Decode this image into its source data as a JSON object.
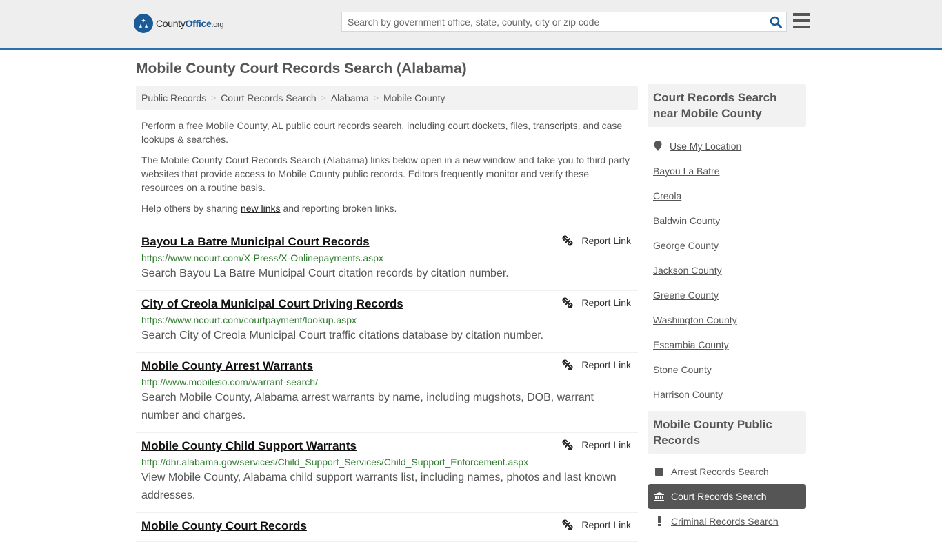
{
  "header": {
    "logo": {
      "county": "County",
      "office": "Office",
      "org": ".org"
    },
    "search_placeholder": "Search by government office, state, county, city or zip code",
    "colors": {
      "brand": "#1b5a98",
      "header_border": "#2d6fa8"
    }
  },
  "page_title": "Mobile County Court Records Search (Alabama)",
  "breadcrumb": [
    "Public Records",
    "Court Records Search",
    "Alabama",
    "Mobile County"
  ],
  "intro": {
    "p1": "Perform a free Mobile County, AL public court records search, including court dockets, files, transcripts, and case lookups & searches.",
    "p2": "The Mobile County Court Records Search (Alabama) links below open in a new window and take you to third party websites that provide access to Mobile County public records. Editors frequently monitor and verify these resources on a routine basis.",
    "p3_before": "Help others by sharing ",
    "p3_link": "new links",
    "p3_after": " and reporting broken links."
  },
  "report_label": "Report Link",
  "results": [
    {
      "title": "Bayou La Batre Municipal Court Records",
      "url": "https://www.ncourt.com/X-Press/X-Onlinepayments.aspx",
      "desc": "Search Bayou La Batre Municipal Court citation records by citation number."
    },
    {
      "title": "City of Creola Municipal Court Driving Records",
      "url": "https://www.ncourt.com/courtpayment/lookup.aspx",
      "desc": "Search City of Creola Municipal Court traffic citations database by citation number."
    },
    {
      "title": "Mobile County Arrest Warrants",
      "url": "http://www.mobileso.com/warrant-search/",
      "desc": "Search Mobile County, Alabama arrest warrants by name, including mugshots, DOB, warrant number and charges."
    },
    {
      "title": "Mobile County Child Support Warrants",
      "url": "http://dhr.alabama.gov/services/Child_Support_Services/Child_Support_Enforcement.aspx",
      "desc": "View Mobile County, Alabama child support warrants list, including names, photos and last known addresses."
    },
    {
      "title": "Mobile County Court Records",
      "url": "",
      "desc": ""
    }
  ],
  "sidebar": {
    "nearby_heading": "Court Records Search near Mobile County",
    "use_location": "Use My Location",
    "nearby": [
      "Bayou La Batre",
      "Creola",
      "Baldwin County",
      "George County",
      "Jackson County",
      "Greene County",
      "Washington County",
      "Escambia County",
      "Stone County",
      "Harrison County"
    ],
    "public_heading": "Mobile County Public Records",
    "public_records": [
      {
        "label": "Arrest Records Search",
        "icon": "square-icon",
        "active": false
      },
      {
        "label": "Court Records Search",
        "icon": "courthouse-icon",
        "active": true
      },
      {
        "label": "Criminal Records Search",
        "icon": "exclamation-icon",
        "active": false
      }
    ]
  }
}
